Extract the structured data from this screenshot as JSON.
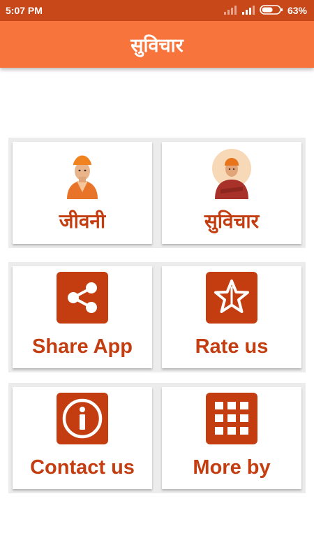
{
  "status_bar": {
    "time": "5:07 PM",
    "battery_percent": "63%",
    "battery_level": 0.63
  },
  "app_bar": {
    "title": "सुविचार"
  },
  "grid": [
    {
      "label": "जीवनी",
      "icon": "portrait-icon"
    },
    {
      "label": "सुविचार",
      "icon": "portrait-folded-arms-icon"
    },
    {
      "label": "Share App",
      "icon": "share-icon"
    },
    {
      "label": "Rate us",
      "icon": "star-icon"
    },
    {
      "label": "Contact us",
      "icon": "info-icon"
    },
    {
      "label": "More by",
      "icon": "grid-icon"
    }
  ],
  "colors": {
    "status_bar": "#c8481a",
    "app_bar": "#f7743d",
    "accent": "#c33d10"
  }
}
